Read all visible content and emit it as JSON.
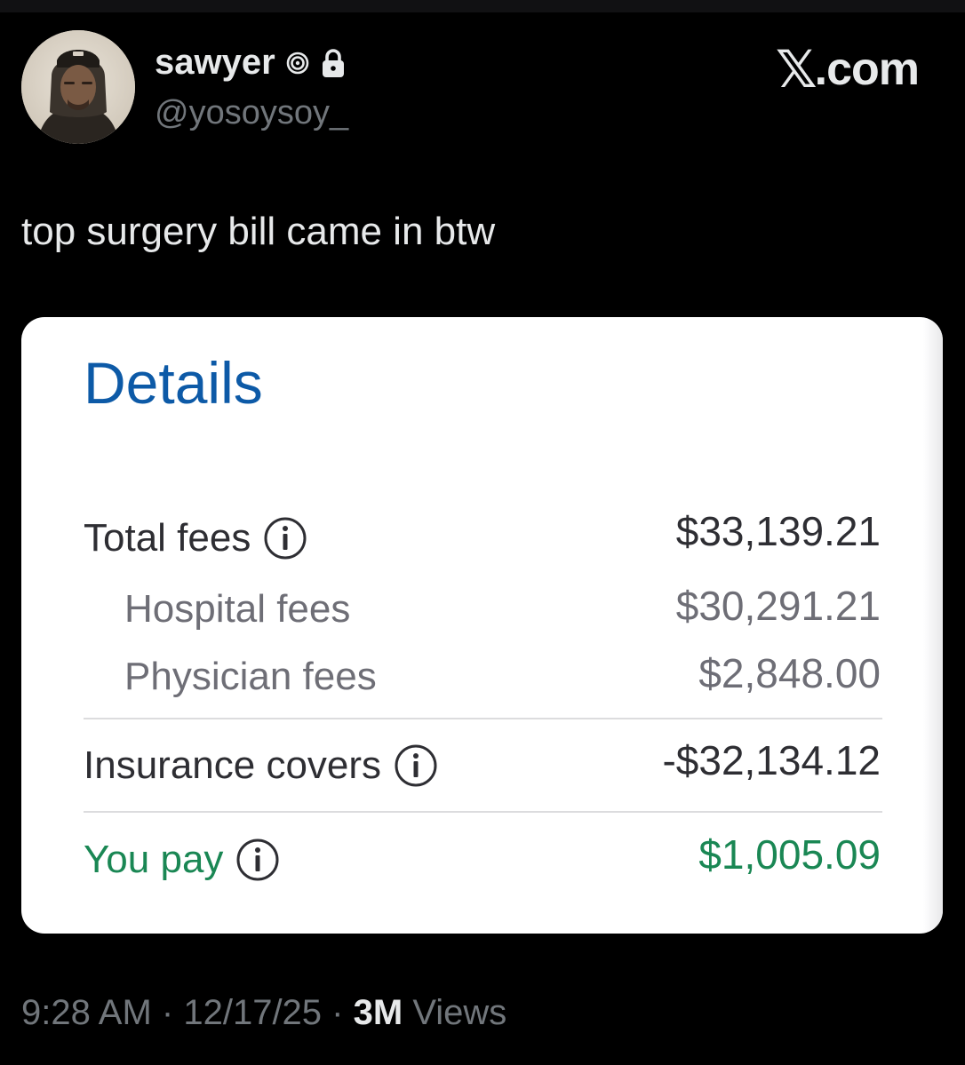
{
  "user": {
    "display_name": "sawyer",
    "handle": "@yosoysoy_",
    "badge_icon": "spiral-icon",
    "protected_icon": "lock-icon"
  },
  "brand": {
    "x_mark": "𝕏",
    "suffix": ".com"
  },
  "tweet": {
    "text": "top surgery bill came in btw"
  },
  "card": {
    "title": "Details",
    "rows": [
      {
        "label": "Total fees",
        "value": "$33,139.21",
        "info_icon": true
      },
      {
        "label": "Hospital fees",
        "value": "$30,291.21"
      },
      {
        "label": "Physician fees",
        "value": "$2,848.00"
      },
      {
        "label": "Insurance covers",
        "value": "-$32,134.12",
        "info_icon": true
      },
      {
        "label": "You pay",
        "value": "$1,005.09",
        "info_icon": true
      }
    ],
    "colors": {
      "title": "#0d5aa7",
      "pay": "#1a8754",
      "text": "#2e2e33",
      "muted": "#6e6e76"
    }
  },
  "meta": {
    "time": "9:28 AM",
    "date": "12/17/25",
    "separator": "·",
    "views_count": "3M",
    "views_label": "Views"
  }
}
